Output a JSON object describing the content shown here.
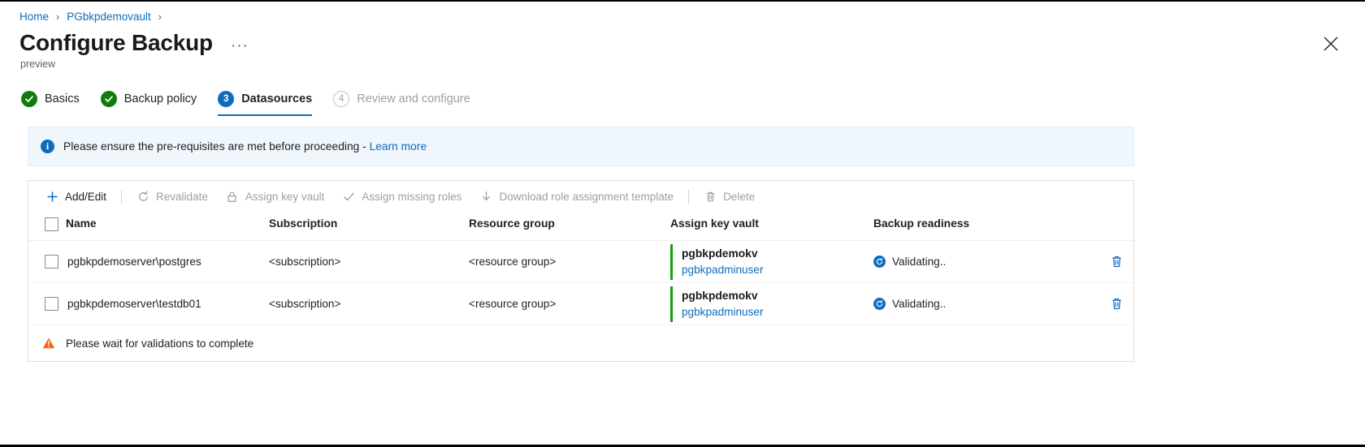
{
  "breadcrumb": {
    "items": [
      {
        "label": "Home"
      },
      {
        "label": "PGbkpdemovault"
      }
    ],
    "separator": "›"
  },
  "header": {
    "title": "Configure Backup",
    "more_label": "···",
    "subtitle": "preview",
    "close_label": "Close"
  },
  "steps": [
    {
      "label": "Basics",
      "state": "done",
      "marker": "✓"
    },
    {
      "label": "Backup policy",
      "state": "done",
      "marker": "✓"
    },
    {
      "label": "Datasources",
      "state": "current",
      "marker": "3"
    },
    {
      "label": "Review and configure",
      "state": "todo",
      "marker": "4"
    }
  ],
  "info_banner": {
    "icon": "info-icon",
    "icon_glyph": "i",
    "text": "Please ensure the pre-requisites are met before proceeding - ",
    "link_label": "Learn more"
  },
  "toolbar": {
    "items": [
      {
        "label": "Add/Edit",
        "icon": "plus-icon",
        "enabled": true
      },
      {
        "label": "Revalidate",
        "icon": "refresh-icon",
        "enabled": false
      },
      {
        "label": "Assign key vault",
        "icon": "lock-icon",
        "enabled": false
      },
      {
        "label": "Assign missing roles",
        "icon": "check-icon",
        "enabled": false
      },
      {
        "label": "Download role assignment template",
        "icon": "download-icon",
        "enabled": false
      },
      {
        "label": "Delete",
        "icon": "trash-icon",
        "enabled": false
      }
    ]
  },
  "table": {
    "columns": [
      "Name",
      "Subscription",
      "Resource group",
      "Assign key vault",
      "Backup readiness"
    ],
    "select_all_label": "Select all",
    "rows": [
      {
        "name": "pgbkpdemoserver\\postgres",
        "subscription": "<subscription>",
        "resource_group": "<resource group>",
        "key_vault": "pgbkpdemokv",
        "key_vault_user": "pgbkpadminuser",
        "readiness": "Validating..",
        "delete_label": "Delete row"
      },
      {
        "name": "pgbkpdemoserver\\testdb01",
        "subscription": "<subscription>",
        "resource_group": "<resource group>",
        "key_vault": "pgbkpdemokv",
        "key_vault_user": "pgbkpadminuser",
        "readiness": "Validating..",
        "delete_label": "Delete row"
      }
    ]
  },
  "footer": {
    "icon": "warning-icon",
    "text": "Please wait for validations to complete"
  },
  "colors": {
    "accent_blue": "#0f6cbd",
    "success_green": "#107c10",
    "vault_accent_green": "#13a10e",
    "warning_orange": "#f7630c",
    "banner_bg": "#eff6fc",
    "disabled_gray": "#a19f9d"
  }
}
